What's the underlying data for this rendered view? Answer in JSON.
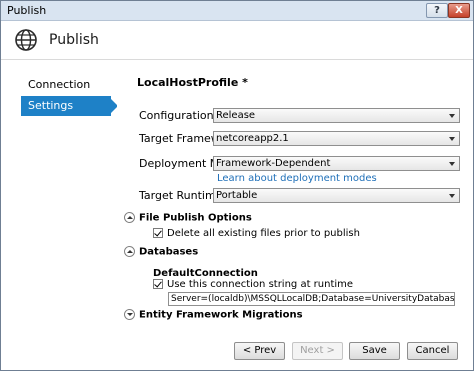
{
  "window": {
    "title": "Publish",
    "help_label": "?",
    "close_label": "X"
  },
  "header": {
    "title": "Publish",
    "icon": "globe-icon"
  },
  "sidebar": {
    "items": [
      {
        "label": "Connection",
        "selected": false
      },
      {
        "label": "Settings",
        "selected": true
      }
    ]
  },
  "main": {
    "profile_name": "LocalHostProfile *",
    "configuration": {
      "label": "Configuration:",
      "value": "Release"
    },
    "target_framework": {
      "label": "Target Framework:",
      "value": "netcoreapp2.1"
    },
    "deployment_mode": {
      "label": "Deployment Mode:",
      "value": "Framework-Dependent"
    },
    "deployment_link": "Learn about deployment modes",
    "target_runtime": {
      "label": "Target Runtime:",
      "value": "Portable"
    },
    "file_publish": {
      "heading": "File Publish Options",
      "delete_existing": {
        "label": "Delete all existing files prior to publish",
        "checked": true
      }
    },
    "databases": {
      "heading": "Databases",
      "connection_name": "DefaultConnection",
      "use_at_runtime": {
        "label": "Use this connection string at runtime",
        "checked": true
      },
      "connection_string": "Server=(localdb)\\MSSQLLocalDB;Database=UniversityDatabase;Trusted_Connection=True;MultipleActiveResultSets=true"
    },
    "ef_migrations": {
      "heading": "Entity Framework Migrations"
    }
  },
  "footer": {
    "prev_label": "< Prev",
    "next_label": "Next >",
    "save_label": "Save",
    "cancel_label": "Cancel"
  },
  "colors": {
    "selection": "#1e81c7",
    "link": "#1e6fb8"
  }
}
